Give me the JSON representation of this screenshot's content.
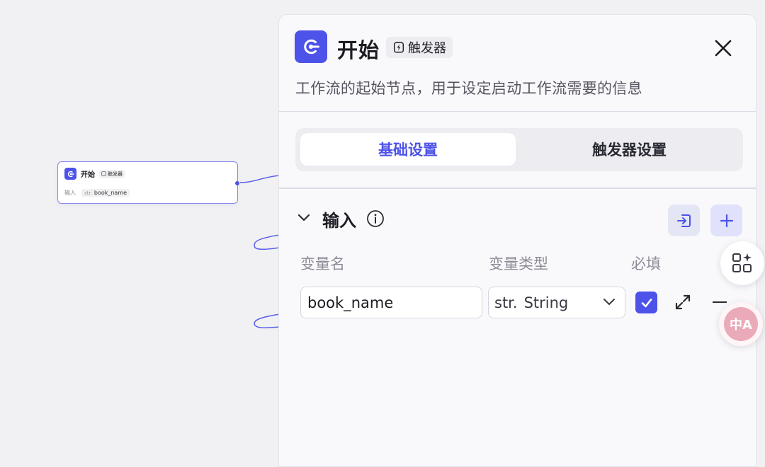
{
  "canvas": {
    "node": {
      "title": "开始",
      "badge": "触发器",
      "input_label": "输入",
      "var_type": "str.",
      "var_name": "book_name"
    }
  },
  "panel": {
    "title": "开始",
    "badge": "触发器",
    "description": "工作流的起始节点，用于设定启动工作流需要的信息",
    "tabs": [
      {
        "label": "基础设置",
        "active": true
      },
      {
        "label": "触发器设置",
        "active": false
      }
    ],
    "section": {
      "title": "输入",
      "columns": {
        "name": "变量名",
        "type": "变量类型",
        "required": "必填"
      },
      "rows": [
        {
          "name": "book_name",
          "type_prefix": "str.",
          "type": "String",
          "required": true
        }
      ]
    }
  },
  "floating": {
    "translate_label": "中A"
  },
  "colors": {
    "accent": "#4d53e8",
    "canvas_bg": "#f1f1f4",
    "panel_bg": "#f9f9fc"
  }
}
